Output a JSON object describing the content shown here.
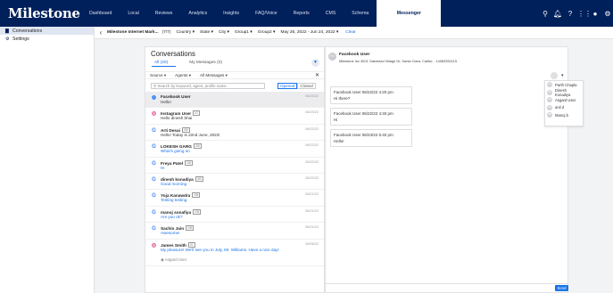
{
  "brand": {
    "logo": "Milestone",
    "accent": "#00205b",
    "link_color": "#1a73e8"
  },
  "nav": {
    "items": [
      "Dashboard",
      "Local",
      "Reviews",
      "Analytics",
      "Insights",
      "FAQ/Voice",
      "Reports",
      "CMS",
      "Schema",
      "Messenger"
    ],
    "active": "Messenger",
    "icons": [
      "search-icon",
      "bell-icon",
      "help-icon",
      "grid-icon",
      "user-icon",
      "gear-icon"
    ]
  },
  "sidebar": {
    "items": [
      {
        "label": "Conversations",
        "icon": "chat-icon"
      },
      {
        "label": "Settings",
        "icon": "gear-icon"
      }
    ]
  },
  "filterbar": {
    "back": "‹",
    "title": "Milestone Internet Mark...",
    "count": "(7/7)",
    "filters": [
      "Country ▾",
      "State ▾",
      "City ▾",
      "Group1 ▾",
      "Group2 ▾",
      "May 26, 2022 - Jun 24, 2022 ▾"
    ],
    "clear": "Clear"
  },
  "conversations": {
    "title": "Conversations",
    "tabs": [
      "All (20)",
      "My Messages (0)"
    ],
    "drops": [
      "Source ▾",
      "Agents ▾",
      "All Messages ▾"
    ],
    "close": "✕",
    "search_placeholder": "Search by keyword, agent, profile name",
    "status": [
      "Opened",
      "Closed"
    ],
    "items": [
      {
        "name": "Facebook User",
        "tag": "",
        "msg": "Hello!",
        "time": "06/23/22",
        "src": "fb",
        "blue": false
      },
      {
        "name": "Instagram User",
        "tag": "IG",
        "msg": "Hello dinesh bhai",
        "time": "06/23/22",
        "src": "ig",
        "blue": false
      },
      {
        "name": "Arti Desai",
        "tag": "GB",
        "msg": "Hello! Today is 22nd June, 2022!",
        "time": "06/22/22",
        "src": "g",
        "blue": false
      },
      {
        "name": "LOKESH GARG",
        "tag": "GB",
        "msg": "What's going on",
        "time": "06/22/22",
        "src": "g",
        "blue": true
      },
      {
        "name": "Freya Patel",
        "tag": "GB",
        "msg": "Hi",
        "time": "06/22/22",
        "src": "g",
        "blue": true
      },
      {
        "name": "dinesh konadiya",
        "tag": "GB",
        "msg": "Good morning",
        "time": "06/22/22",
        "src": "g",
        "blue": true
      },
      {
        "name": "Yoja Kanawdra",
        "tag": "GB",
        "msg": "Testing testing",
        "time": "06/21/22",
        "src": "g",
        "blue": true
      },
      {
        "name": "manoj sonafiya",
        "tag": "GB",
        "msg": "Are you ok?",
        "time": "06/21/22",
        "src": "g",
        "blue": true
      },
      {
        "name": "Sachin Jain",
        "tag": "GB",
        "msg": "Awesome!",
        "time": "06/21/22",
        "src": "g",
        "blue": true
      },
      {
        "name": "James Smith",
        "tag": "IG",
        "msg": "My pleasure! We'll see you in July, Mr. Williams. Have a nice day!",
        "time": "06/06/22",
        "src": "ig",
        "blue": true,
        "sub": "Asgard User"
      }
    ]
  },
  "chat": {
    "avatar": "FU",
    "name": "Facebook User",
    "info": "Milestone Inc    3001 Oakmead Village Dr, Santa Clara, Califor...    14083352115",
    "bubbles": [
      {
        "head": "Facebook User 06/22/22 4:20 pm",
        "text": "Hi there?"
      },
      {
        "head": "Facebook User 06/22/22 4:40 pm",
        "text": "Hi"
      },
      {
        "head": "Facebook User 06/23/22 5:40 pm",
        "text": "Hello!"
      }
    ],
    "agents": [
      "Parth Chapla",
      "Dinesh Konadiya",
      "Asgard User",
      "anil d",
      "Manoj b"
    ],
    "send": "Send"
  }
}
